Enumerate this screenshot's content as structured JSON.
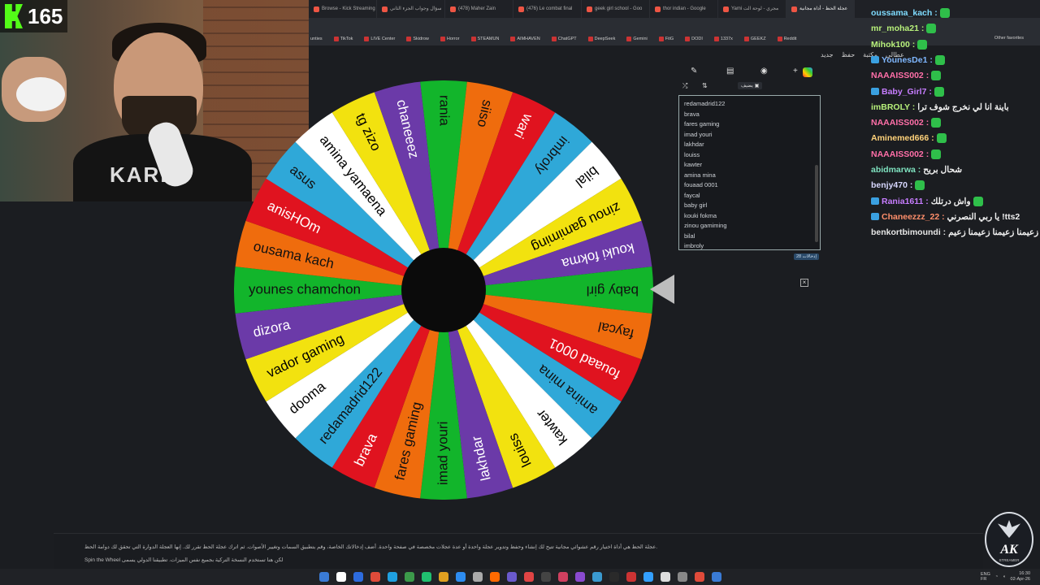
{
  "browser": {
    "tabs": [
      "Browse - Kick Streaming",
      "سؤال وجواب الجزء الثاني",
      "(478) Maher Zain",
      "(476) Le combat final",
      "geek girl school - Goo",
      "thor indian - Google",
      "Yami مجري - لوحة الت",
      "عجلة الحظ - أداة مجانية"
    ],
    "active_tab_index": 7,
    "bookmarks": [
      "TikTok",
      "LIVE Center",
      "Skidrow",
      "Horror",
      "STEAMUN",
      "AIMHAVEN",
      "ChatGPT",
      "DeepSeek",
      "Gemini",
      "FitG",
      "DODI",
      "1337x",
      "GEEKZ",
      "Reddit"
    ],
    "bookmarks_prefix": "unties",
    "other_favorites": "Other favorites",
    "page_menu": [
      "جديد",
      "حفظ",
      "مكتبة",
      "عطالي"
    ]
  },
  "stream": {
    "viewer_count": "165",
    "shirt_text": "KARL\nLAGERFE"
  },
  "wheel": {
    "entries": [
      "rania",
      "siiso",
      "wari",
      "imbroly",
      "bilal",
      "zinou gamiming",
      "kouki fokma",
      "baby girl",
      "faycal",
      "fouaad 0001",
      "amina mina",
      "kawter",
      "louiss",
      "lakhdar",
      "imad youri",
      "fares gaming",
      "brava",
      "redamadrid122",
      "dooma",
      "vador gaming",
      "dizora",
      "younes chamchon",
      "ousama kach",
      "anisHOm",
      "asus",
      "amina yamaena",
      "tg zizo",
      "chaneeez"
    ],
    "colors": [
      "#12b52b",
      "#ef6c0d",
      "#e0131f",
      "#2fa8d8",
      "#ffffff",
      "#f2e20f",
      "#6b3aa8"
    ],
    "entries_list": [
      "redamadrid122",
      "brava",
      "fares gaming",
      "imad youri",
      "lakhdar",
      "louiss",
      "kawter",
      "amina mina",
      "fouaad 0001",
      "faycal",
      "baby girl",
      "kouki fokma",
      "zinou gamiming",
      "bilal",
      "imbroly"
    ],
    "entries_count": "28 إدخالات",
    "add_button": "يضيف"
  },
  "chat": [
    {
      "user": "oussama_kach",
      "color": "#7fdcff",
      "msg": "",
      "badge": false,
      "emote": true
    },
    {
      "user": "mr_moha21",
      "color": "#b7f07a",
      "msg": "",
      "badge": false,
      "emote": true
    },
    {
      "user": "Mihok100",
      "color": "#b7f07a",
      "msg": "",
      "badge": false,
      "emote": true
    },
    {
      "user": "YounesDe1",
      "color": "#7fb7ff",
      "msg": "",
      "badge": true,
      "emote": true
    },
    {
      "user": "NAAAISS002",
      "color": "#ff6fa8",
      "msg": "",
      "badge": false,
      "emote": true
    },
    {
      "user": "Baby_Girl7",
      "color": "#c77dff",
      "msg": "",
      "badge": true,
      "emote": true
    },
    {
      "user": "imBROLY",
      "color": "#b7f07a",
      "msg": "باينة انا لي نخرج شوف ترا",
      "badge": false,
      "emote": false
    },
    {
      "user": "NAAAISS002",
      "color": "#ff6fa8",
      "msg": "",
      "badge": false,
      "emote": true
    },
    {
      "user": "Aminemed666",
      "color": "#ffd27a",
      "msg": "",
      "badge": false,
      "emote": true
    },
    {
      "user": "NAAAISS002",
      "color": "#ff6fa8",
      "msg": "",
      "badge": false,
      "emote": true
    },
    {
      "user": "abidmarwa",
      "color": "#7fe3c0",
      "msg": "شحال بريح",
      "badge": false,
      "emote": false
    },
    {
      "user": "benjy470",
      "color": "#d8d8ff",
      "msg": "",
      "badge": false,
      "emote": true
    },
    {
      "user": "Rania1611",
      "color": "#c77dff",
      "msg": "واش درتلك",
      "badge": true,
      "emote": true
    },
    {
      "user": "Chaneezzz_22",
      "color": "#ff8f6b",
      "msg": "يا ربي النصرني !tts2",
      "badge": true,
      "emote": false
    },
    {
      "user": "benkortbimoundi",
      "color": "#e6e6e6",
      "msg": "زعيمنا زعيمنا زعيمنا زعيم",
      "badge": false,
      "emote": false
    }
  ],
  "footer": {
    "line1": "عجلة الحظ هي أداة اختيار رقم عشوائي مجانية تتيح لك إنشاء وحفظ وتدوير عجلة واحدة أو عدة عجلات مخصصة في صفحة واحدة. أضف إدخالاتك الخاصة، وقم بتطبيق السمات وتغيير الأصوات. ثم اترك عجلة الحظ تقرر لك. إنها العجلة الدوارة التي تحقق لك دوامة الحظ.",
    "line2": "Spin the Wheel لكن هنا تستخدم النسخة التركية بجميع نفس الميزات. تطبيقنا الدولي يسمى"
  },
  "taskbar": {
    "lang": "ENG\nFR",
    "time": "16:30",
    "date": "02-Apr-26"
  },
  "logo": {
    "name": "AK",
    "sub": "STREAMER"
  }
}
